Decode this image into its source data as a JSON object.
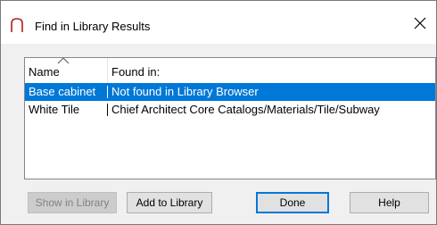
{
  "window": {
    "title": "Find in Library Results"
  },
  "list": {
    "columns": [
      "Name",
      "Found in:"
    ],
    "rows": [
      {
        "name": "Base cabinet",
        "found_in": "Not found in Library Browser",
        "selected": true
      },
      {
        "name": "White Tile",
        "found_in": "Chief Architect Core Catalogs/Materials/Tile/Subway",
        "selected": false
      }
    ],
    "sort_indicator_icon": "sort-ascending-caret"
  },
  "buttons": {
    "show_in_library": "Show in Library",
    "add_to_library": "Add to Library",
    "done": "Done",
    "help": "Help"
  },
  "colors": {
    "selection": "#0078d7",
    "dialog_background": "#f0f0f0",
    "disabled_text": "#838383"
  }
}
